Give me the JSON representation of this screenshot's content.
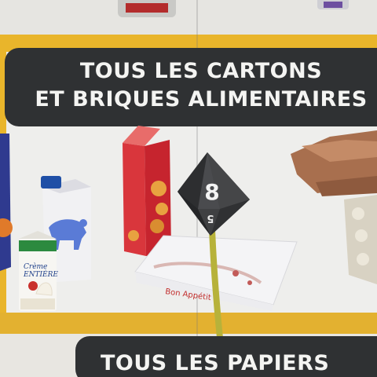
{
  "header": {
    "line1": "TOUS LES CARTONS",
    "line2": "ET BRIQUES ALIMENTAIRES"
  },
  "footer": {
    "label": "TOUS LES PAPIERS"
  },
  "products": {
    "cream_brand_line1": "Crème",
    "cream_brand_line2": "ENTIÈRE",
    "pizza_box_text": "Bon Appétit !"
  },
  "die": {
    "top_face_number": "8",
    "bottom_face_number": "5"
  },
  "colors": {
    "sign_yellow": "#e9b52b",
    "label_dark": "#2f3133",
    "die_body": "#3a3b3d",
    "stem_yellow": "#b7b23a"
  }
}
